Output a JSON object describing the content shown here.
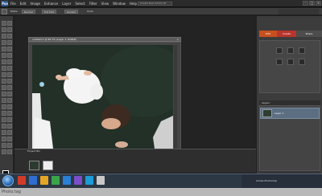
{
  "app": {
    "logo": "Pse"
  },
  "menu": [
    "File",
    "Edit",
    "Image",
    "Enhance",
    "Layer",
    "Select",
    "Filter",
    "View",
    "Window",
    "Help"
  ],
  "titlebar": {
    "search_label": "Create New Adobe ID",
    "buttons": [
      "–",
      "□",
      "×"
    ]
  },
  "options": {
    "mode_label": "Mode:",
    "chip1": "Normal",
    "chip2": "Full Edit",
    "extra": "Guided",
    "undo_label": "Undo"
  },
  "document": {
    "title": "untitled-1 @ 66.7% (Layer 1, RGB/8)",
    "close": "×",
    "status": "66.67%"
  },
  "panels": {
    "tabs": [
      {
        "label": "Edit",
        "color": "#c8501e"
      },
      {
        "label": "Create",
        "color": "#b8342c"
      },
      {
        "label": "Share",
        "color": "#4d4d4d"
      }
    ],
    "layers_header": "Layers",
    "layer_name": "Layer 1"
  },
  "project_bin": {
    "label": "Project Bin"
  },
  "taskbar": {
    "icons": [
      "#d23b2a",
      "#2f6dd0",
      "#e3a526",
      "#3aa44a",
      "#2b7fd4",
      "#7a4fc9",
      "#1d9cd6",
      "#c8c8c8"
    ],
    "tray": "Adobe Photoshop"
  },
  "footer": {
    "label": "Photo.tag"
  }
}
